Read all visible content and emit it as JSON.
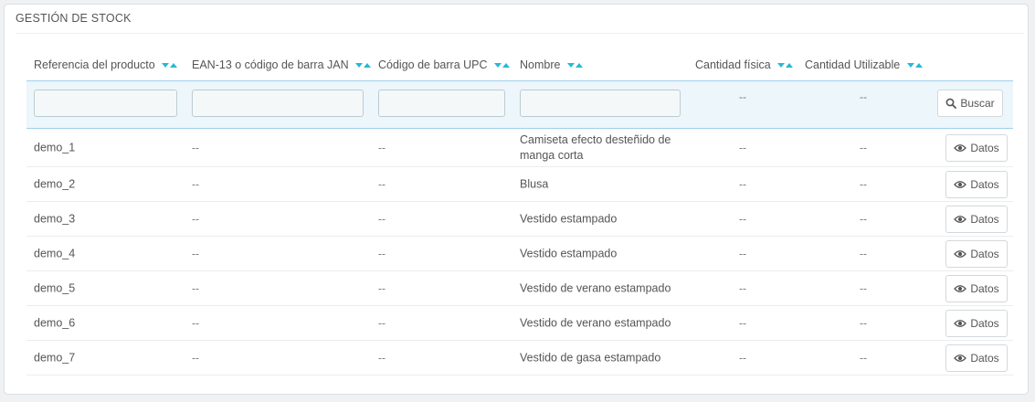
{
  "panel": {
    "title": "GESTIÓN DE STOCK"
  },
  "columns": {
    "ref": "Referencia del producto",
    "ean": "EAN-13 o código de barra JAN",
    "upc": "Código de barra UPC",
    "name": "Nombre",
    "physical": "Cantidad física",
    "usable": "Cantidad Utilizable"
  },
  "filters": {
    "physical_dash": "--",
    "usable_dash": "--",
    "search_label": "Buscar"
  },
  "rows": [
    {
      "ref": "demo_1",
      "ean": "--",
      "upc": "--",
      "name": "Camiseta efecto desteñido de manga corta",
      "physical": "--",
      "usable": "--",
      "action": "Datos"
    },
    {
      "ref": "demo_2",
      "ean": "--",
      "upc": "--",
      "name": "Blusa",
      "physical": "--",
      "usable": "--",
      "action": "Datos"
    },
    {
      "ref": "demo_3",
      "ean": "--",
      "upc": "--",
      "name": "Vestido estampado",
      "physical": "--",
      "usable": "--",
      "action": "Datos"
    },
    {
      "ref": "demo_4",
      "ean": "--",
      "upc": "--",
      "name": "Vestido estampado",
      "physical": "--",
      "usable": "--",
      "action": "Datos"
    },
    {
      "ref": "demo_5",
      "ean": "--",
      "upc": "--",
      "name": "Vestido de verano estampado",
      "physical": "--",
      "usable": "--",
      "action": "Datos"
    },
    {
      "ref": "demo_6",
      "ean": "--",
      "upc": "--",
      "name": "Vestido de verano estampado",
      "physical": "--",
      "usable": "--",
      "action": "Datos"
    },
    {
      "ref": "demo_7",
      "ean": "--",
      "upc": "--",
      "name": "Vestido de gasa estampado",
      "physical": "--",
      "usable": "--",
      "action": "Datos"
    }
  ],
  "icons": {
    "search": "search-icon",
    "view": "eye-icon",
    "sort_desc": "sort-desc-icon",
    "sort_asc": "sort-asc-icon"
  },
  "colors": {
    "accent": "#25b9d7",
    "filter_bg": "#ecf6fb",
    "border": "#a0d0eb"
  }
}
